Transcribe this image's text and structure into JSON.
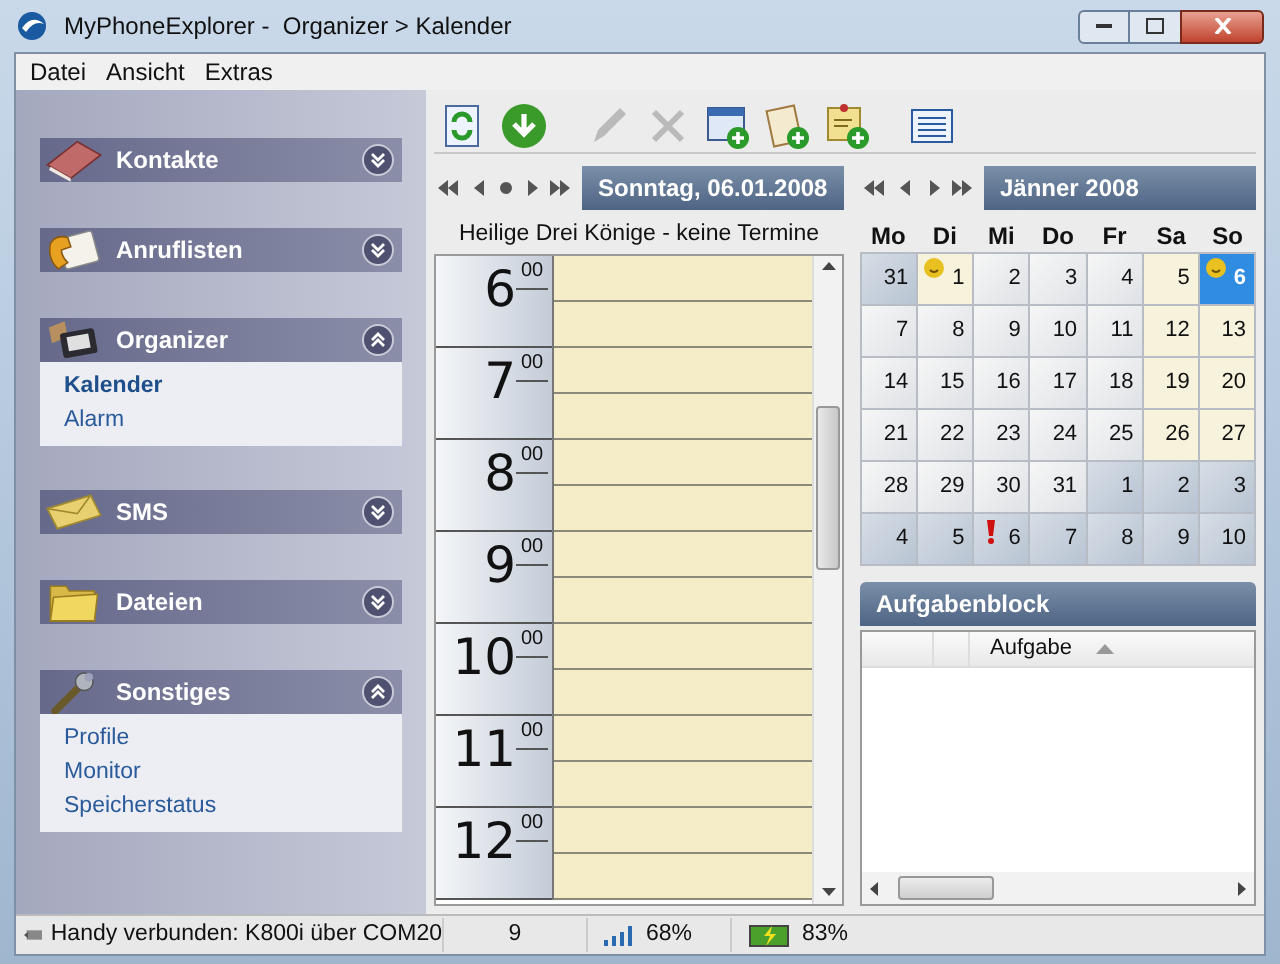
{
  "window": {
    "title": "MyPhoneExplorer -  Organizer > Kalender"
  },
  "menu": [
    "Datei",
    "Ansicht",
    "Extras"
  ],
  "sidebar": {
    "groups": [
      {
        "kind": "contacts",
        "label": "Kontakte",
        "expanded": false
      },
      {
        "kind": "calls",
        "label": "Anruflisten",
        "expanded": false
      },
      {
        "kind": "organizer",
        "label": "Organizer",
        "expanded": true,
        "items": [
          {
            "label": "Kalender",
            "selected": true
          },
          {
            "label": "Alarm",
            "selected": false
          }
        ]
      },
      {
        "kind": "sms",
        "label": "SMS",
        "expanded": false
      },
      {
        "kind": "files",
        "label": "Dateien",
        "expanded": false
      },
      {
        "kind": "misc",
        "label": "Sonstiges",
        "expanded": true,
        "items": [
          {
            "label": "Profile",
            "selected": false
          },
          {
            "label": "Monitor",
            "selected": false
          },
          {
            "label": "Speicherstatus",
            "selected": false
          }
        ]
      }
    ]
  },
  "toolbar": [
    {
      "kind": "refresh",
      "disabled": false
    },
    {
      "kind": "download",
      "disabled": false
    },
    {
      "kind": "edit",
      "disabled": true
    },
    {
      "kind": "delete",
      "disabled": true
    },
    {
      "kind": "new-event",
      "disabled": false
    },
    {
      "kind": "new-task",
      "disabled": false
    },
    {
      "kind": "new-note",
      "disabled": false
    },
    {
      "kind": "list",
      "disabled": false
    }
  ],
  "day_view": {
    "date": "Sonntag, 06.01.2008",
    "caption": "Heilige Drei Könige - keine Termine",
    "hours": [
      {
        "hour": "6",
        "minutes": "00"
      },
      {
        "hour": "7",
        "minutes": "00"
      },
      {
        "hour": "8",
        "minutes": "00"
      },
      {
        "hour": "9",
        "minutes": "00"
      },
      {
        "hour": "10",
        "minutes": "00"
      },
      {
        "hour": "11",
        "minutes": "00"
      },
      {
        "hour": "12",
        "minutes": "00"
      }
    ]
  },
  "month_view": {
    "month": "Jänner 2008",
    "weekdays": [
      "Mo",
      "Di",
      "Mi",
      "Do",
      "Fr",
      "Sa",
      "So"
    ],
    "days": [
      {
        "day": "31",
        "kind": "other",
        "selected": false
      },
      {
        "day": "1",
        "kind": "free",
        "selected": false,
        "holiday": true
      },
      {
        "day": "2",
        "kind": "work",
        "selected": false
      },
      {
        "day": "3",
        "kind": "work",
        "selected": false
      },
      {
        "day": "4",
        "kind": "work",
        "selected": false
      },
      {
        "day": "5",
        "kind": "free",
        "selected": false
      },
      {
        "day": "6",
        "kind": "free",
        "selected": true,
        "holiday": true
      },
      {
        "day": "7",
        "kind": "work",
        "selected": false
      },
      {
        "day": "8",
        "kind": "work",
        "selected": false
      },
      {
        "day": "9",
        "kind": "work",
        "selected": false
      },
      {
        "day": "10",
        "kind": "work",
        "selected": false
      },
      {
        "day": "11",
        "kind": "work",
        "selected": false
      },
      {
        "day": "12",
        "kind": "free",
        "selected": false
      },
      {
        "day": "13",
        "kind": "free",
        "selected": false
      },
      {
        "day": "14",
        "kind": "work",
        "selected": false
      },
      {
        "day": "15",
        "kind": "work",
        "selected": false
      },
      {
        "day": "16",
        "kind": "work",
        "selected": false
      },
      {
        "day": "17",
        "kind": "work",
        "selected": false
      },
      {
        "day": "18",
        "kind": "work",
        "selected": false
      },
      {
        "day": "19",
        "kind": "free",
        "selected": false
      },
      {
        "day": "20",
        "kind": "free",
        "selected": false
      },
      {
        "day": "21",
        "kind": "work",
        "selected": false
      },
      {
        "day": "22",
        "kind": "work",
        "selected": false
      },
      {
        "day": "23",
        "kind": "work",
        "selected": false
      },
      {
        "day": "24",
        "kind": "work",
        "selected": false
      },
      {
        "day": "25",
        "kind": "work",
        "selected": false
      },
      {
        "day": "26",
        "kind": "free",
        "selected": false
      },
      {
        "day": "27",
        "kind": "free",
        "selected": false
      },
      {
        "day": "28",
        "kind": "work",
        "selected": false
      },
      {
        "day": "29",
        "kind": "work",
        "selected": false
      },
      {
        "day": "30",
        "kind": "work",
        "selected": false
      },
      {
        "day": "31",
        "kind": "work",
        "selected": false
      },
      {
        "day": "1",
        "kind": "other",
        "selected": false
      },
      {
        "day": "2",
        "kind": "other",
        "selected": false
      },
      {
        "day": "3",
        "kind": "other",
        "selected": false
      },
      {
        "day": "4",
        "kind": "other",
        "selected": false
      },
      {
        "day": "5",
        "kind": "other",
        "selected": false
      },
      {
        "day": "6",
        "kind": "other",
        "selected": false,
        "alarm": true
      },
      {
        "day": "7",
        "kind": "other",
        "selected": false
      },
      {
        "day": "8",
        "kind": "other",
        "selected": false
      },
      {
        "day": "9",
        "kind": "other",
        "selected": false
      },
      {
        "day": "10",
        "kind": "other",
        "selected": false
      }
    ]
  },
  "tasks": {
    "title": "Aufgabenblock",
    "columns": [
      "Aufgabe"
    ]
  },
  "status_bar": {
    "connection": "Handy verbunden: K800i über COM20",
    "count": "9",
    "signal": "68%",
    "battery": "83%"
  }
}
